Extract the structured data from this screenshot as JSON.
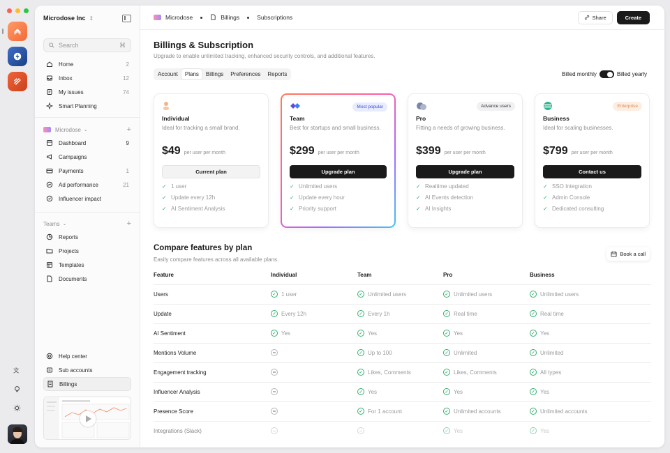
{
  "colors": {
    "accent_dark": "#1a1a1a",
    "check_green": "#31b06e",
    "popular_badge": "#e8ecff",
    "enterprise_badge": "#fdeee3"
  },
  "dock": {
    "apps": [
      {
        "icon": "stack-icon",
        "color": "#f97a45"
      },
      {
        "icon": "bolt-icon",
        "color": "#1f5fbf"
      },
      {
        "icon": "stripes-icon",
        "color": "#e85a2a"
      }
    ]
  },
  "sidebar": {
    "workspace": "Microdose Inc",
    "search": {
      "placeholder": "Search",
      "shortcut": "⌘"
    },
    "main_items": [
      {
        "label": "Home",
        "count": "2",
        "icon": "home-icon"
      },
      {
        "label": "Inbox",
        "count": "12",
        "icon": "inbox-icon"
      },
      {
        "label": "My issues",
        "count": "74",
        "icon": "issues-icon"
      },
      {
        "label": "Smart Planning",
        "count": "",
        "icon": "sparkle-icon"
      }
    ],
    "workspace_section": "Microdose",
    "workspace_items": [
      {
        "label": "Dashboard",
        "count": "9",
        "icon": "dashboard-icon"
      },
      {
        "label": "Campaigns",
        "count": "",
        "icon": "megaphone-icon"
      },
      {
        "label": "Payments",
        "count": "1",
        "icon": "card-icon"
      },
      {
        "label": "Ad performance",
        "count": "21",
        "icon": "chart-icon"
      },
      {
        "label": "Influencer impact",
        "count": "",
        "icon": "target-icon"
      }
    ],
    "teams_section": "Teams",
    "team_items": [
      {
        "label": "Reports",
        "icon": "pie-icon"
      },
      {
        "label": "Projects",
        "icon": "folder-icon"
      },
      {
        "label": "Templates",
        "icon": "template-icon"
      },
      {
        "label": "Documents",
        "icon": "document-icon"
      }
    ],
    "bottom_items": [
      {
        "label": "Help center",
        "icon": "help-icon"
      },
      {
        "label": "Sub accounts",
        "icon": "accounts-icon"
      },
      {
        "label": "Billings",
        "icon": "billing-icon"
      }
    ]
  },
  "topbar": {
    "breadcrumb": [
      "Microdose",
      "Billings",
      "Subscriptions"
    ],
    "share_label": "Share",
    "create_label": "Create"
  },
  "page": {
    "title": "Billings & Subscription",
    "subtitle": "Upgrade to enable unlimited tracking, enhanced security controls, and additional features.",
    "tabs": [
      "Account",
      "Plans",
      "Billings",
      "Preferences",
      "Reports"
    ],
    "active_tab": "Plans",
    "billed_monthly": "Billed monthly",
    "billed_yearly": "Billed yearly"
  },
  "plans": [
    {
      "name": "Individual",
      "desc": "Ideal for tracking a small brand.",
      "price": "$49",
      "per": "per user per month",
      "button": "Current plan",
      "badge": "",
      "features": [
        "1 user",
        "Update every 12h",
        "AI Sentiment Analysis"
      ]
    },
    {
      "name": "Team",
      "desc": "Best for startups and small business.",
      "price": "$299",
      "per": "per user per month",
      "button": "Upgrade plan",
      "badge": "Most popular",
      "features": [
        "Unlimited users",
        "Update every hour",
        "Priority support"
      ]
    },
    {
      "name": "Pro",
      "desc": "Fitting a needs of growing business.",
      "price": "$399",
      "per": "per user per month",
      "button": "Upgrade plan",
      "badge": "Advance users",
      "features": [
        "Realtime updated",
        "AI Events detection",
        "AI Insights"
      ]
    },
    {
      "name": "Business",
      "desc": "Ideal for scaling businesses.",
      "price": "$799",
      "per": "per user per month",
      "button": "Contact us",
      "badge": "Enterprise",
      "features": [
        "SSO Integration",
        "Admin Console",
        "Dedicated consulting"
      ]
    }
  ],
  "compare": {
    "title": "Compare features by plan",
    "subtitle": "Easily compare features across all available plans.",
    "book_label": "Book a call",
    "headers": [
      "Feature",
      "Individual",
      "Team",
      "Pro",
      "Business"
    ],
    "rows": [
      {
        "feature": "Users",
        "values": [
          "1 user",
          "Unlimited users",
          "Unlimited users",
          "Unlimited users"
        ]
      },
      {
        "feature": "Update",
        "values": [
          "Every 12h",
          "Every 1h",
          "Real time",
          "Real time"
        ]
      },
      {
        "feature": "AI Sentiment",
        "values": [
          "Yes",
          "Yes",
          "Yes",
          "Yes"
        ]
      },
      {
        "feature": "Mentions Volume",
        "values": [
          "",
          "Up to 100",
          "Unlimited",
          "Unlimited"
        ]
      },
      {
        "feature": "Engagement tracking",
        "values": [
          "",
          "Likes, Comments",
          "Likes, Comments",
          "All types"
        ]
      },
      {
        "feature": "Influencer Analysis",
        "values": [
          "",
          "Yes",
          "Yes",
          "Yes"
        ]
      },
      {
        "feature": "Presence Score",
        "values": [
          "",
          "For 1 account",
          "Unlimited accounts",
          "Unlimited accounts"
        ]
      },
      {
        "feature": "Integrations (Slack)",
        "values": [
          "",
          "",
          "Yes",
          "Yes"
        ]
      }
    ]
  }
}
